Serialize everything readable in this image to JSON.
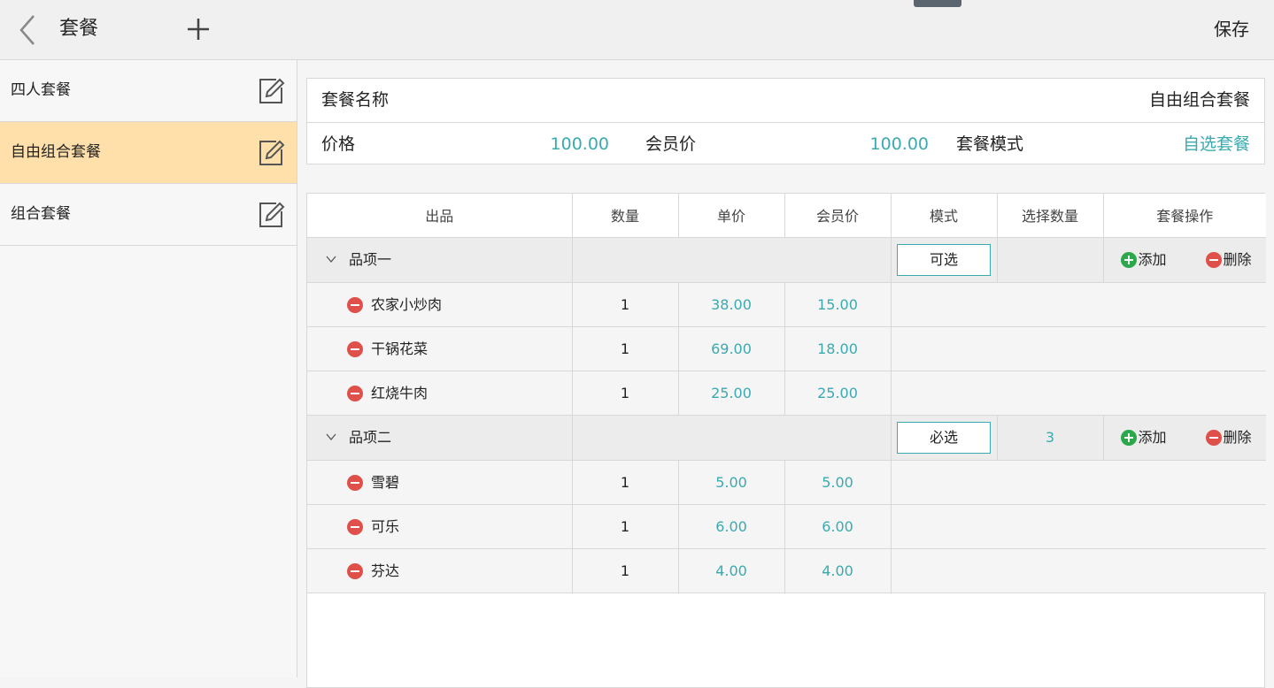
{
  "header": {
    "title": "套餐",
    "save_label": "保存"
  },
  "sidebar": {
    "items": [
      {
        "label": "四人套餐",
        "active": false
      },
      {
        "label": "自由组合套餐",
        "active": true
      },
      {
        "label": "组合套餐",
        "active": false
      }
    ]
  },
  "info": {
    "name_label": "套餐名称",
    "name_value": "自由组合套餐",
    "price_label": "价格",
    "price_value": "100.00",
    "member_price_label": "会员价",
    "member_price_value": "100.00",
    "mode_label": "套餐模式",
    "mode_value": "自选套餐"
  },
  "table": {
    "headers": [
      "出品",
      "数量",
      "单价",
      "会员价",
      "模式",
      "选择数量",
      "套餐操作"
    ],
    "add_label": "添加",
    "delete_label": "删除",
    "groups": [
      {
        "name": "品项一",
        "mode": "可选",
        "select_count": "",
        "items": [
          {
            "name": "农家小炒肉",
            "qty": "1",
            "price": "38.00",
            "member_price": "15.00"
          },
          {
            "name": "干锅花菜",
            "qty": "1",
            "price": "69.00",
            "member_price": "18.00"
          },
          {
            "name": "红烧牛肉",
            "qty": "1",
            "price": "25.00",
            "member_price": "25.00"
          }
        ]
      },
      {
        "name": "品项二",
        "mode": "必选",
        "select_count": "3",
        "items": [
          {
            "name": "雪碧",
            "qty": "1",
            "price": "5.00",
            "member_price": "5.00"
          },
          {
            "name": "可乐",
            "qty": "1",
            "price": "6.00",
            "member_price": "6.00"
          },
          {
            "name": "芬达",
            "qty": "1",
            "price": "4.00",
            "member_price": "4.00"
          }
        ]
      }
    ]
  },
  "colors": {
    "accent": "#3aaab0",
    "active_item": "#ffe0ab",
    "add_green": "#2aa84a",
    "delete_red": "#e0504a"
  }
}
